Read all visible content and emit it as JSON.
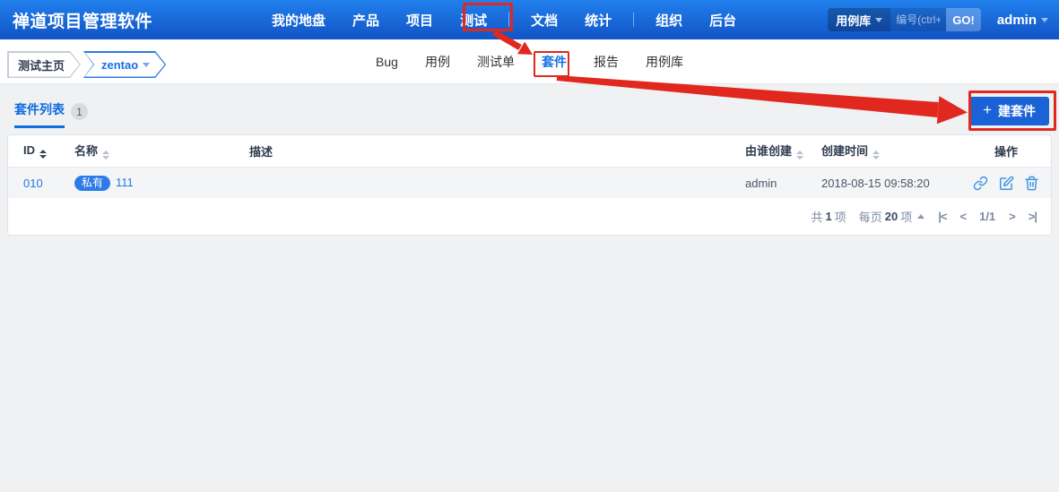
{
  "colors": {
    "header_blue_top": "#2080ec",
    "header_blue_bottom": "#1254c6",
    "accent_blue": "#1a6fe0",
    "annotation_red": "#e0281e",
    "badge_blue": "#2d7be8",
    "action_icon_blue": "#3f97e3"
  },
  "header": {
    "app_title": "禅道项目管理软件",
    "nav": [
      {
        "label": "我的地盘"
      },
      {
        "label": "产品"
      },
      {
        "label": "项目"
      },
      {
        "label": "测试",
        "active": true
      },
      {
        "label": "文档"
      },
      {
        "label": "统计"
      },
      {
        "label": "组织"
      },
      {
        "label": "后台"
      }
    ],
    "search": {
      "module_label": "用例库",
      "placeholder": "编号(ctrl+",
      "go_label": "GO!"
    },
    "user_label": "admin"
  },
  "subheader": {
    "breadcrumb": [
      {
        "label": "测试主页"
      },
      {
        "label": "zentao",
        "has_caret": true
      }
    ],
    "tabs": [
      {
        "label": "Bug"
      },
      {
        "label": "用例"
      },
      {
        "label": "测试单"
      },
      {
        "label": "套件",
        "active": true
      },
      {
        "label": "报告"
      },
      {
        "label": "用例库"
      }
    ]
  },
  "toolbar": {
    "list_tab_label": "套件列表",
    "count_badge": "1",
    "plus": "+",
    "create_label": "建套件"
  },
  "table": {
    "headers": [
      {
        "label": "ID",
        "sortable": true
      },
      {
        "label": "名称",
        "sortable": true
      },
      {
        "label": "描述",
        "sortable": false
      },
      {
        "label": "由谁创建",
        "sortable": true
      },
      {
        "label": "创建时间",
        "sortable": true
      },
      {
        "label": "操作",
        "sortable": false
      }
    ],
    "rows": [
      {
        "id": "010",
        "badge": "私有",
        "name": "111",
        "creator": "admin",
        "created": "2018-08-15 09:58:20",
        "action_icons": [
          {
            "name": "link-icon"
          },
          {
            "name": "edit-icon"
          },
          {
            "name": "trash-icon"
          }
        ]
      }
    ]
  },
  "pagination": {
    "total_pre": "共",
    "total_num": "1",
    "total_suf": "项",
    "perpage_pre": "每页",
    "perpage_num": "20",
    "perpage_suf": "项",
    "first": "|<",
    "prev": "<",
    "page": "1/1",
    "next": ">",
    "last": ">|"
  }
}
